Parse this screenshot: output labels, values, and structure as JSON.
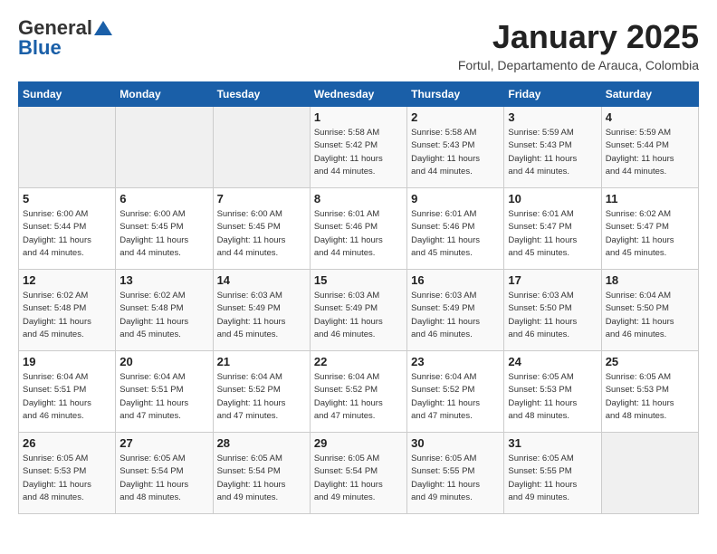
{
  "header": {
    "logo_general": "General",
    "logo_blue": "Blue",
    "title": "January 2025",
    "subtitle": "Fortul, Departamento de Arauca, Colombia"
  },
  "days_of_week": [
    "Sunday",
    "Monday",
    "Tuesday",
    "Wednesday",
    "Thursday",
    "Friday",
    "Saturday"
  ],
  "weeks": [
    [
      {
        "day": "",
        "info": ""
      },
      {
        "day": "",
        "info": ""
      },
      {
        "day": "",
        "info": ""
      },
      {
        "day": "1",
        "info": "Sunrise: 5:58 AM\nSunset: 5:42 PM\nDaylight: 11 hours\nand 44 minutes."
      },
      {
        "day": "2",
        "info": "Sunrise: 5:58 AM\nSunset: 5:43 PM\nDaylight: 11 hours\nand 44 minutes."
      },
      {
        "day": "3",
        "info": "Sunrise: 5:59 AM\nSunset: 5:43 PM\nDaylight: 11 hours\nand 44 minutes."
      },
      {
        "day": "4",
        "info": "Sunrise: 5:59 AM\nSunset: 5:44 PM\nDaylight: 11 hours\nand 44 minutes."
      }
    ],
    [
      {
        "day": "5",
        "info": "Sunrise: 6:00 AM\nSunset: 5:44 PM\nDaylight: 11 hours\nand 44 minutes."
      },
      {
        "day": "6",
        "info": "Sunrise: 6:00 AM\nSunset: 5:45 PM\nDaylight: 11 hours\nand 44 minutes."
      },
      {
        "day": "7",
        "info": "Sunrise: 6:00 AM\nSunset: 5:45 PM\nDaylight: 11 hours\nand 44 minutes."
      },
      {
        "day": "8",
        "info": "Sunrise: 6:01 AM\nSunset: 5:46 PM\nDaylight: 11 hours\nand 44 minutes."
      },
      {
        "day": "9",
        "info": "Sunrise: 6:01 AM\nSunset: 5:46 PM\nDaylight: 11 hours\nand 45 minutes."
      },
      {
        "day": "10",
        "info": "Sunrise: 6:01 AM\nSunset: 5:47 PM\nDaylight: 11 hours\nand 45 minutes."
      },
      {
        "day": "11",
        "info": "Sunrise: 6:02 AM\nSunset: 5:47 PM\nDaylight: 11 hours\nand 45 minutes."
      }
    ],
    [
      {
        "day": "12",
        "info": "Sunrise: 6:02 AM\nSunset: 5:48 PM\nDaylight: 11 hours\nand 45 minutes."
      },
      {
        "day": "13",
        "info": "Sunrise: 6:02 AM\nSunset: 5:48 PM\nDaylight: 11 hours\nand 45 minutes."
      },
      {
        "day": "14",
        "info": "Sunrise: 6:03 AM\nSunset: 5:49 PM\nDaylight: 11 hours\nand 45 minutes."
      },
      {
        "day": "15",
        "info": "Sunrise: 6:03 AM\nSunset: 5:49 PM\nDaylight: 11 hours\nand 46 minutes."
      },
      {
        "day": "16",
        "info": "Sunrise: 6:03 AM\nSunset: 5:49 PM\nDaylight: 11 hours\nand 46 minutes."
      },
      {
        "day": "17",
        "info": "Sunrise: 6:03 AM\nSunset: 5:50 PM\nDaylight: 11 hours\nand 46 minutes."
      },
      {
        "day": "18",
        "info": "Sunrise: 6:04 AM\nSunset: 5:50 PM\nDaylight: 11 hours\nand 46 minutes."
      }
    ],
    [
      {
        "day": "19",
        "info": "Sunrise: 6:04 AM\nSunset: 5:51 PM\nDaylight: 11 hours\nand 46 minutes."
      },
      {
        "day": "20",
        "info": "Sunrise: 6:04 AM\nSunset: 5:51 PM\nDaylight: 11 hours\nand 47 minutes."
      },
      {
        "day": "21",
        "info": "Sunrise: 6:04 AM\nSunset: 5:52 PM\nDaylight: 11 hours\nand 47 minutes."
      },
      {
        "day": "22",
        "info": "Sunrise: 6:04 AM\nSunset: 5:52 PM\nDaylight: 11 hours\nand 47 minutes."
      },
      {
        "day": "23",
        "info": "Sunrise: 6:04 AM\nSunset: 5:52 PM\nDaylight: 11 hours\nand 47 minutes."
      },
      {
        "day": "24",
        "info": "Sunrise: 6:05 AM\nSunset: 5:53 PM\nDaylight: 11 hours\nand 48 minutes."
      },
      {
        "day": "25",
        "info": "Sunrise: 6:05 AM\nSunset: 5:53 PM\nDaylight: 11 hours\nand 48 minutes."
      }
    ],
    [
      {
        "day": "26",
        "info": "Sunrise: 6:05 AM\nSunset: 5:53 PM\nDaylight: 11 hours\nand 48 minutes."
      },
      {
        "day": "27",
        "info": "Sunrise: 6:05 AM\nSunset: 5:54 PM\nDaylight: 11 hours\nand 48 minutes."
      },
      {
        "day": "28",
        "info": "Sunrise: 6:05 AM\nSunset: 5:54 PM\nDaylight: 11 hours\nand 49 minutes."
      },
      {
        "day": "29",
        "info": "Sunrise: 6:05 AM\nSunset: 5:54 PM\nDaylight: 11 hours\nand 49 minutes."
      },
      {
        "day": "30",
        "info": "Sunrise: 6:05 AM\nSunset: 5:55 PM\nDaylight: 11 hours\nand 49 minutes."
      },
      {
        "day": "31",
        "info": "Sunrise: 6:05 AM\nSunset: 5:55 PM\nDaylight: 11 hours\nand 49 minutes."
      },
      {
        "day": "",
        "info": ""
      }
    ]
  ]
}
